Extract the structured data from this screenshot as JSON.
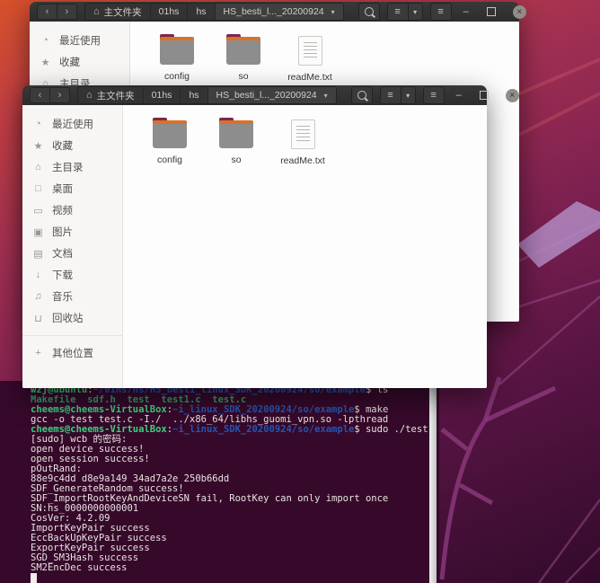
{
  "icons": {
    "back": "‹",
    "forward": "›",
    "home": "⌂",
    "caret": "▾",
    "list": "≡",
    "menu": "≡",
    "close": "×",
    "recent": "◔",
    "star": "★",
    "desktop": "□",
    "video": "▭",
    "image": "▣",
    "document": "▤",
    "download": "↓",
    "music": "♫",
    "trash": "⊔",
    "plus": "+"
  },
  "colors": {
    "titlebar": "#323232",
    "sidebar_bg": "#f7f6f5",
    "content_bg": "#fdfdfd",
    "terminal_bg": "#36092b",
    "prompt_green": "#3cd17d",
    "path_blue": "#2456b3",
    "folder_gray": "#8d8d8d",
    "folder_accent_orange": "#d9712b",
    "folder_flap_maroon": "#79284f"
  },
  "window1": {
    "breadcrumb": [
      "主文件夹",
      "01hs",
      "hs",
      "HS_besti_l..._20200924"
    ],
    "sidebar_items": [
      {
        "icon": "recent",
        "label": "最近使用"
      },
      {
        "icon": "star",
        "label": "收藏"
      },
      {
        "icon": "home",
        "label": "主目录"
      }
    ],
    "files": [
      {
        "type": "folder",
        "label": "config"
      },
      {
        "type": "folder",
        "label": "so"
      },
      {
        "type": "text",
        "label": "readMe.txt"
      }
    ]
  },
  "window2": {
    "breadcrumb": [
      "主文件夹",
      "01hs",
      "hs",
      "HS_besti_l..._20200924"
    ],
    "sidebar_items": [
      {
        "icon": "recent",
        "label": "最近使用"
      },
      {
        "icon": "star",
        "label": "收藏"
      },
      {
        "icon": "home",
        "label": "主目录"
      },
      {
        "icon": "desktop",
        "label": "桌面"
      },
      {
        "icon": "video",
        "label": "视频"
      },
      {
        "icon": "image",
        "label": "图片"
      },
      {
        "icon": "document",
        "label": "文档"
      },
      {
        "icon": "download",
        "label": "下载"
      },
      {
        "icon": "music",
        "label": "音乐"
      },
      {
        "icon": "trash",
        "label": "回收站"
      }
    ],
    "other_locations": {
      "icon": "plus",
      "label": "其他位置"
    },
    "files": [
      {
        "type": "folder",
        "label": "config"
      },
      {
        "type": "folder",
        "label": "so"
      },
      {
        "type": "text",
        "label": "readMe.txt"
      }
    ]
  },
  "terminal": {
    "lines": [
      {
        "segments": [
          {
            "text": "wzj@ubuntu",
            "color": "green"
          },
          {
            "text": ":",
            "color": "white"
          },
          {
            "text": "~/01hs/hs/HS_besti_linux_SDK_20200924/so/example",
            "color": "blue"
          },
          {
            "text": "$ ls",
            "color": "white"
          }
        ]
      },
      {
        "segments": [
          {
            "text": "Makefile  sdf.h  test  test1.c  test.c",
            "color": "files"
          }
        ]
      },
      {
        "segments": [
          {
            "text": "cheems@cheems-VirtualBox",
            "color": "green"
          },
          {
            "text": ":",
            "color": "white"
          },
          {
            "text": "~i_linux_SDK_20200924/so/example",
            "color": "blue"
          },
          {
            "text": "$ make",
            "color": "white"
          }
        ]
      },
      {
        "segments": [
          {
            "text": "gcc -o test test.c -I./  ../x86_64/libhs_guomi_vpn.so -lpthread",
            "color": "white"
          }
        ]
      },
      {
        "segments": [
          {
            "text": "cheems@cheems-VirtualBox",
            "color": "green"
          },
          {
            "text": ":",
            "color": "white"
          },
          {
            "text": "~i_linux_SDK_20200924/so/example",
            "color": "blue"
          },
          {
            "text": "$ sudo ./test",
            "color": "white"
          }
        ]
      },
      {
        "segments": [
          {
            "text": "[sudo] wcb 的密码:",
            "color": "white"
          }
        ]
      },
      {
        "segments": [
          {
            "text": "open device success!",
            "color": "white"
          }
        ]
      },
      {
        "segments": [
          {
            "text": "open session success!",
            "color": "white"
          }
        ]
      },
      {
        "segments": [
          {
            "text": "pOutRand:",
            "color": "white"
          }
        ]
      },
      {
        "segments": [
          {
            "text": "88e9c4dd d8e9a149 34ad7a2e 250b66dd",
            "color": "white"
          }
        ]
      },
      {
        "segments": [
          {
            "text": "SDF_GenerateRandom success!",
            "color": "white"
          }
        ]
      },
      {
        "segments": [
          {
            "text": "SDF_ImportRootKeyAndDeviceSN fail, RootKey can only import once",
            "color": "white"
          }
        ]
      },
      {
        "segments": [
          {
            "text": "SN:hs_0000000000001",
            "color": "white"
          }
        ]
      },
      {
        "segments": [
          {
            "text": "CosVer: 4.2.09",
            "color": "white"
          }
        ]
      },
      {
        "segments": [
          {
            "text": "ImportKeyPair success",
            "color": "white"
          }
        ]
      },
      {
        "segments": [
          {
            "text": "EccBackUpKeyPair success",
            "color": "white"
          }
        ]
      },
      {
        "segments": [
          {
            "text": "ExportKeyPair success",
            "color": "white"
          }
        ]
      },
      {
        "segments": [
          {
            "text": "SGD_SM3Hash success",
            "color": "white"
          }
        ]
      },
      {
        "segments": [
          {
            "text": "SM2EncDec success",
            "color": "white"
          }
        ]
      }
    ]
  }
}
